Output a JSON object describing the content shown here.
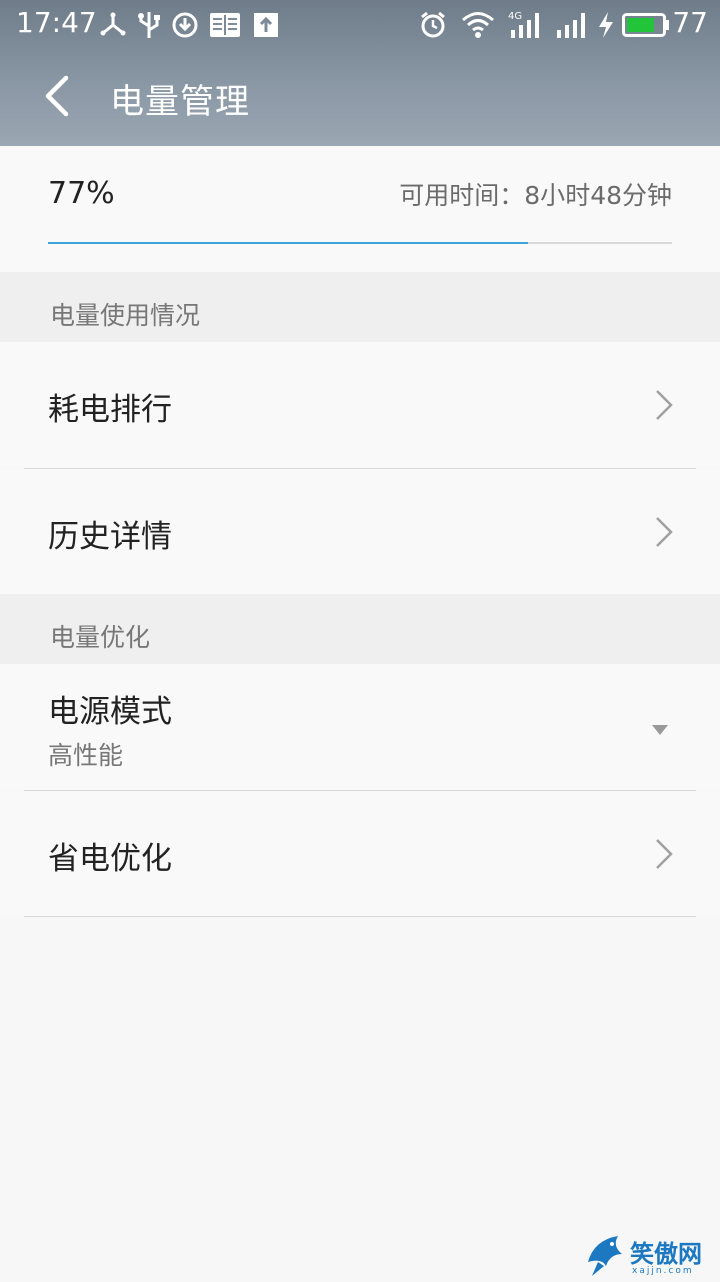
{
  "status_bar": {
    "time": "17:47",
    "battery_level": "77",
    "left_icons": [
      "share-icon",
      "usb-icon",
      "download-icon",
      "reader-icon",
      "upload-icon"
    ],
    "right_icons": [
      "alarm-icon",
      "wifi-icon",
      "signal-4g-icon",
      "signal-icon",
      "charging-icon",
      "battery-icon"
    ],
    "battery_color": "#22c43a"
  },
  "header": {
    "title": "电量管理",
    "back_icon": "chevron-left-icon"
  },
  "battery": {
    "percent_text": "77%",
    "remaining_text": "可用时间：8小时48分钟",
    "level_fraction": 0.77,
    "bar_color": "#3aa6d8"
  },
  "sections": [
    {
      "title": "电量使用情况",
      "items": [
        {
          "label": "耗电排行"
        },
        {
          "label": "历史详情"
        }
      ]
    },
    {
      "title": "电量优化",
      "items": [
        {
          "label": "电源模式",
          "value": "高性能"
        },
        {
          "label": "省电优化"
        }
      ]
    }
  ],
  "watermark": {
    "text": "笑傲网",
    "sub": "xajjn.com"
  }
}
